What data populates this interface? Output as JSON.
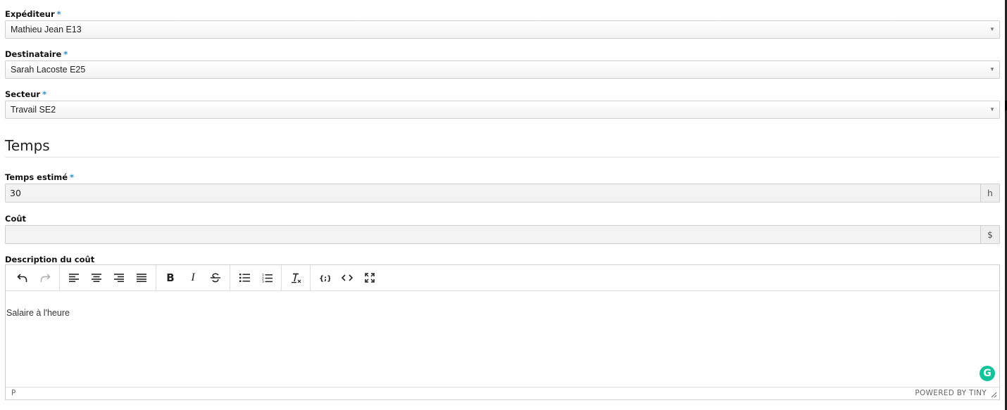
{
  "sender": {
    "label": "Expéditeur",
    "required": "*",
    "value": "Mathieu Jean E13",
    "arrow": "▼"
  },
  "recipient": {
    "label": "Destinataire",
    "required": "*",
    "value": "Sarah Lacoste E25",
    "arrow": "▼"
  },
  "sector": {
    "label": "Secteur",
    "required": "*",
    "value": "Travail SE2",
    "arrow": "▼"
  },
  "time_section": {
    "heading": "Temps"
  },
  "estimated_time": {
    "label": "Temps estimé",
    "required": "*",
    "value": "30",
    "unit": "h"
  },
  "cost": {
    "label": "Coût",
    "value": "",
    "unit": "$"
  },
  "cost_description": {
    "label": "Description du coût",
    "toolbar": {
      "groups": [
        [
          "undo-icon",
          "redo-icon"
        ],
        [
          "align-left-icon",
          "align-center-icon",
          "align-right-icon",
          "align-justify-icon"
        ],
        [
          "bold-icon",
          "italic-icon",
          "strikethrough-icon"
        ],
        [
          "bullet-list-icon",
          "numbered-list-icon"
        ],
        [
          "clear-formatting-icon"
        ],
        [
          "template-icon",
          "source-code-icon",
          "fullscreen-icon"
        ]
      ],
      "bold_glyph": "B",
      "italic_glyph": "I"
    },
    "content": "Salaire à l'heure",
    "status_path": "P",
    "powered_by": "POWERED BY TINY",
    "grammarly_glyph": "G"
  },
  "colors": {
    "required_star": "#2a8fd0",
    "grammarly": "#15c39a"
  }
}
